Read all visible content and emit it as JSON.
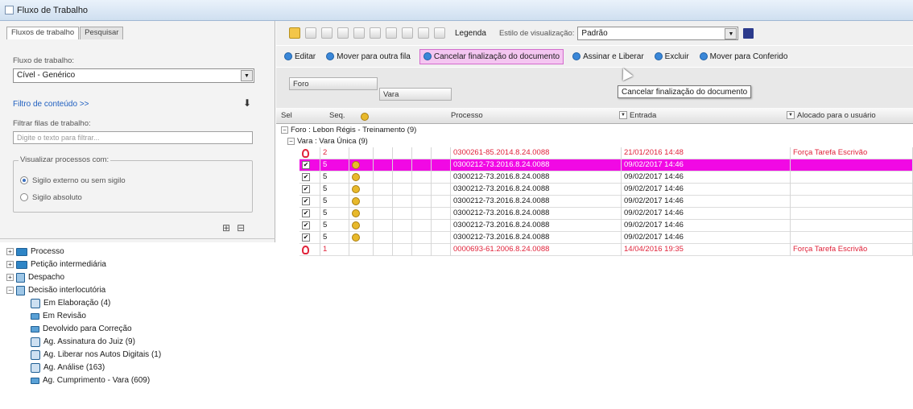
{
  "window": {
    "title": "Fluxo de Trabalho"
  },
  "left": {
    "tabs": [
      {
        "label": "Fluxos de trabalho"
      },
      {
        "label": "Pesquisar"
      }
    ],
    "fluxo_label": "Fluxo de trabalho:",
    "fluxo_value": "Cível - Genérico",
    "filtro_link": "Filtro de conteúdo >>",
    "filtrar_label": "Filtrar filas de trabalho:",
    "filtrar_placeholder": "Digite o texto para filtrar...",
    "visualizar_label": "Visualizar processos com:",
    "radios": [
      {
        "label": "Sigilo externo ou sem sigilo"
      },
      {
        "label": "Sigilo absoluto"
      }
    ],
    "tree": [
      {
        "label": "Processo"
      },
      {
        "label": "Petição intermediária"
      },
      {
        "label": "Despacho"
      },
      {
        "label": "Decisão interlocutória"
      },
      {
        "label": "Em Elaboração (4)"
      },
      {
        "label": "Em Revisão"
      },
      {
        "label": "Devolvido para Correção"
      },
      {
        "label": "Ag. Assinatura do Juiz (9)"
      },
      {
        "label": "Ag. Liberar nos Autos Digitais (1)"
      },
      {
        "label": "Ag. Análise (163)"
      },
      {
        "label": "Ag. Cumprimento - Vara (609)"
      }
    ]
  },
  "toolbar1": {
    "legenda": "Legenda",
    "estilo_label": "Estilo de visualização:",
    "estilo_value": "Padrão"
  },
  "toolbar2": {
    "actions": [
      {
        "label": "Editar"
      },
      {
        "label": "Mover para outra fila"
      },
      {
        "label": "Cancelar finalização do documento"
      },
      {
        "label": "Assinar e Liberar"
      },
      {
        "label": "Excluir"
      },
      {
        "label": "Mover para Conferido"
      }
    ]
  },
  "tooltip": "Cancelar finalização do documento",
  "group_chips": {
    "foro": "Foro",
    "vara": "Vara"
  },
  "grid": {
    "headers": {
      "sel": "Sel",
      "seq": "Seq.",
      "processo": "Processo",
      "entrada": "Entrada",
      "alocado": "Alocado para o usuário"
    },
    "foro_group": "Foro : Lebon Régis - Treinamento (9)",
    "vara_group": "Vara : Vara Única (9)",
    "rows": [
      {
        "seq": "2",
        "processo": "0300261-85.2014.8.24.0088",
        "entrada": "21/01/2016 14:48",
        "alocado": "Força Tarefa Escrivão"
      },
      {
        "seq": "5",
        "processo": "0300212-73.2016.8.24.0088",
        "entrada": "09/02/2017 14:46",
        "alocado": ""
      },
      {
        "seq": "5",
        "processo": "0300212-73.2016.8.24.0088",
        "entrada": "09/02/2017 14:46",
        "alocado": ""
      },
      {
        "seq": "5",
        "processo": "0300212-73.2016.8.24.0088",
        "entrada": "09/02/2017 14:46",
        "alocado": ""
      },
      {
        "seq": "5",
        "processo": "0300212-73.2016.8.24.0088",
        "entrada": "09/02/2017 14:46",
        "alocado": ""
      },
      {
        "seq": "5",
        "processo": "0300212-73.2016.8.24.0088",
        "entrada": "09/02/2017 14:46",
        "alocado": ""
      },
      {
        "seq": "5",
        "processo": "0300212-73.2016.8.24.0088",
        "entrada": "09/02/2017 14:46",
        "alocado": ""
      },
      {
        "seq": "5",
        "processo": "0300212-73.2016.8.24.0088",
        "entrada": "09/02/2017 14:46",
        "alocado": ""
      },
      {
        "seq": "1",
        "processo": "0000693-61.2006.8.24.0088",
        "entrada": "14/04/2016 19:35",
        "alocado": "Força Tarefa Escrivão"
      }
    ]
  }
}
